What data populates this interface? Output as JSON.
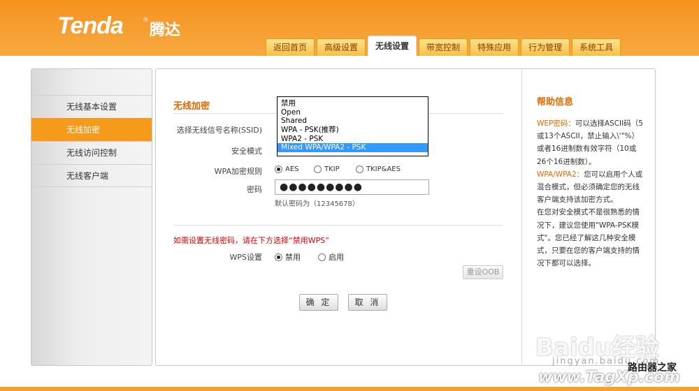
{
  "brand": {
    "logo": "Tenda",
    "logo_cn": "腾达"
  },
  "nav": {
    "tabs": [
      "返回首页",
      "高级设置",
      "无线设置",
      "带宽控制",
      "特殊应用",
      "行为管理",
      "系统工具"
    ],
    "active": "无线设置"
  },
  "sidebar": {
    "items": [
      {
        "label": "无线基本设置",
        "active": false
      },
      {
        "label": "无线加密",
        "active": true
      },
      {
        "label": "无线访问控制",
        "active": false
      },
      {
        "label": "无线客户端",
        "active": false
      }
    ]
  },
  "form": {
    "section_title": "无线加密",
    "ssid_label": "选择无线信号名称(SSID)",
    "mode_label": "安全模式",
    "mode_options": [
      "禁用",
      "Open",
      "Shared",
      "WPA - PSK(推荐)",
      "WPA2 - PSK",
      "Mixed WPA/WPA2 - PSK"
    ],
    "mode_selected": "Mixed WPA/WPA2 - PSK",
    "wpa_label": "WPA加密规则",
    "wpa_options": [
      "AES",
      "TKIP",
      "TKIP&AES"
    ],
    "wpa_selected": "AES",
    "password_label": "密码",
    "password_value": "●●●●●●●●●",
    "password_hint": "默认密码为（12345678）",
    "wps_note": "如需设置无线密码，请在下方选择“禁用WPS”",
    "wps_label": "WPS设置",
    "wps_options": [
      "禁用",
      "启用"
    ],
    "wps_selected": "禁用",
    "reset_oob": "重设OOB",
    "ok": "确 定",
    "cancel": "取 消"
  },
  "help": {
    "title": "帮助信息",
    "wep_key": "WEP密码：",
    "wep_text": "可以选择ASCII码（5或13个ASCII，禁止输入\\'\"%）或者16进制数有效字符（10或26个16进制数）。",
    "wpa_key": "WPA/WPA2：",
    "wpa_text": "您可以启用个人或混合模式，但必须确定您的无线客户端支持该加密方式。",
    "advice": "在您对安全模式不是很熟悉的情况下，建议您使用\"WPA-PSK模式\"。您已经了解这几种安全模式，只要在您的客户端支持的情况下都可以选择。"
  },
  "watermark": {
    "baidu": "Baidu经验",
    "baidu_sub": "jingyan.baidu.com",
    "site_cn": "路由器之家",
    "site_en": "www.TagXp.com"
  }
}
